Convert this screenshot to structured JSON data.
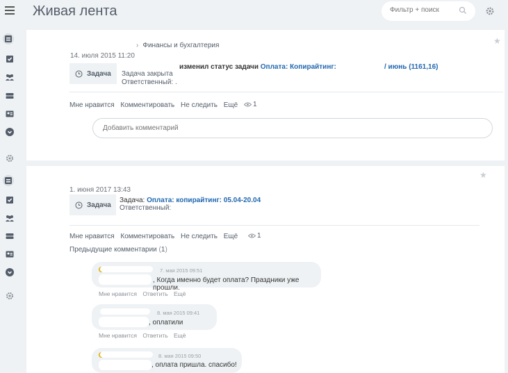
{
  "header": {
    "title": "Живая лента",
    "search_placeholder": "Фильтр + поиск"
  },
  "post1": {
    "breadcrumb": "Финансы и бухгалтерия",
    "date": "14. июля 2015 11:20",
    "status_text": "изменил статус задачи",
    "task_link": "Оплата: Копирайтинг:",
    "task_link_tail": "/ июнь (1161,16)",
    "task_label": "Задача",
    "task_closed": "Задача закрыта",
    "responsible": "Ответственный:",
    "responsible_tail": ".",
    "actions": {
      "like": "Мне нравится",
      "comment": "Комментировать",
      "unfollow": "Не следить",
      "more": "Ещё",
      "views": "1"
    },
    "comment_placeholder": "Добавить комментарий"
  },
  "post2": {
    "date": "1. июня 2017 13:43",
    "task_label": "Задача",
    "task_prefix": "Задача:",
    "task_link": "Оплата: копирайтинг: 05.04-20.04",
    "responsible": "Ответственный:",
    "actions": {
      "like": "Мне нравится",
      "comment": "Комментировать",
      "unfollow": "Не следить",
      "more": "Ещё",
      "views": "1"
    },
    "prev_comments": "Предыдущие комментарии",
    "prev_count_open": "(",
    "prev_count": "1",
    "prev_count_close": ")",
    "comments": [
      {
        "date": "7. мая 2015 09:51",
        "text": ", Когда именно будет оплата? Праздники уже прошли."
      },
      {
        "date": "8. мая 2015 09:41",
        "text": ", оплатили"
      },
      {
        "date": "8. мая 2015 09:50",
        "text": ", оплата пришла. спасибо!"
      }
    ],
    "comment_actions": {
      "like": "Мне нравится",
      "reply": "Ответить",
      "more": "Ещё"
    }
  }
}
